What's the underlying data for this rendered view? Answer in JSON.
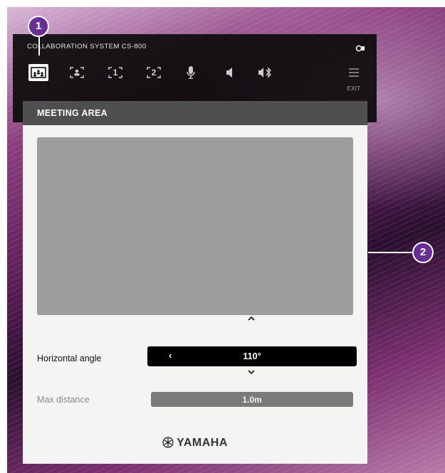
{
  "window": {
    "title": "COLLABORATION SYSTEM CS-800"
  },
  "toolbar": {
    "buttons": [
      {
        "name": "meeting-area-button",
        "icon": "meeting-area-icon",
        "active": true
      },
      {
        "name": "speaker-framing-button",
        "icon": "speaker-framing-icon",
        "active": false
      },
      {
        "name": "preset-1-button",
        "icon": "preset-1-icon",
        "label": "1",
        "active": false
      },
      {
        "name": "preset-2-button",
        "icon": "preset-2-icon",
        "label": "2",
        "active": false
      },
      {
        "name": "microphone-button",
        "icon": "microphone-icon",
        "active": false
      },
      {
        "name": "speaker-volume-button",
        "icon": "speaker-icon",
        "active": false
      },
      {
        "name": "bluetooth-audio-button",
        "icon": "bluetooth-speaker-icon",
        "active": false
      }
    ],
    "exit_label": "EXIT"
  },
  "panel": {
    "title": "MEETING AREA",
    "horizontal_angle": {
      "label": "Horizontal angle",
      "value": "110°",
      "decrement": "‹"
    },
    "max_distance": {
      "label": "Max distance",
      "value": "1.0m"
    },
    "brand": "YAMAHA"
  },
  "callouts": {
    "one": "1",
    "two": "2"
  },
  "colors": {
    "callout": "#6a2f96",
    "toolbar_bg": "#0c0c0c",
    "panel_header": "#4f4f4f",
    "preview": "#9d9d9d"
  }
}
